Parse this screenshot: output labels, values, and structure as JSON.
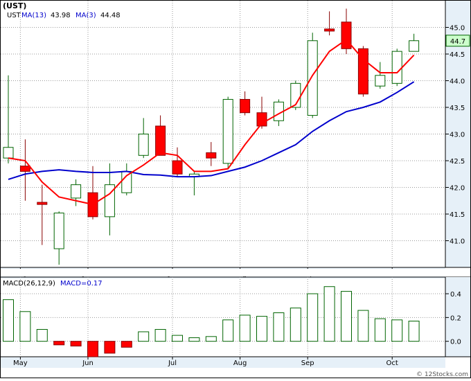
{
  "header": {
    "ticker": "(UST)",
    "symbol": "UST",
    "ma13_label": "MA(13)",
    "ma13_value": "43.98",
    "ma3_label": "MA(3)",
    "ma3_value": "44.48"
  },
  "macd_header": {
    "label": "MACD(26,12,9)",
    "value_label": "MACD=0.17"
  },
  "footer": {
    "copyright": "© 12Stocks.com"
  },
  "colors": {
    "up_candle_stroke": "#006400",
    "down_candle_fill": "#ff0000",
    "ma13_line": "#0000cc",
    "ma3_line": "#ff0000",
    "macd_bar": "#006400",
    "price_axis_bg": "#e6f0f8",
    "last_price_bg": "#ccffcc",
    "grid": "#999999"
  },
  "chart_data": [
    {
      "type": "candlestick",
      "title": "(UST)",
      "ylim": [
        40.5,
        45.5
      ],
      "y_ticks": [
        41.0,
        41.5,
        42.0,
        42.5,
        43.0,
        43.5,
        44.0,
        44.5,
        45.0
      ],
      "x_ticks": [
        {
          "label": "May",
          "index": 1
        },
        {
          "label": "Jun",
          "index": 5
        },
        {
          "label": "Jul",
          "index": 10
        },
        {
          "label": "Aug",
          "index": 14
        },
        {
          "label": "Sep",
          "index": 18
        },
        {
          "label": "Oct",
          "index": 23
        }
      ],
      "last_price_label": "44.7",
      "candles": [
        {
          "o": 42.55,
          "h": 44.1,
          "l": 42.45,
          "c": 42.75
        },
        {
          "o": 42.4,
          "h": 42.9,
          "l": 41.75,
          "c": 42.3
        },
        {
          "o": 41.72,
          "h": 42.05,
          "l": 40.92,
          "c": 41.68
        },
        {
          "o": 40.85,
          "h": 41.55,
          "l": 40.55,
          "c": 41.52
        },
        {
          "o": 41.8,
          "h": 42.15,
          "l": 41.65,
          "c": 42.05
        },
        {
          "o": 41.9,
          "h": 42.4,
          "l": 41.4,
          "c": 41.45
        },
        {
          "o": 41.45,
          "h": 42.45,
          "l": 41.1,
          "c": 42.05
        },
        {
          "o": 41.9,
          "h": 42.45,
          "l": 41.85,
          "c": 42.3
        },
        {
          "o": 42.6,
          "h": 43.3,
          "l": 42.55,
          "c": 43.0
        },
        {
          "o": 43.15,
          "h": 43.35,
          "l": 42.6,
          "c": 42.6
        },
        {
          "o": 42.5,
          "h": 42.75,
          "l": 42.2,
          "c": 42.25
        },
        {
          "o": 42.2,
          "h": 42.3,
          "l": 41.85,
          "c": 42.25
        },
        {
          "o": 42.65,
          "h": 42.85,
          "l": 42.4,
          "c": 42.55
        },
        {
          "o": 42.45,
          "h": 43.7,
          "l": 42.35,
          "c": 43.65
        },
        {
          "o": 43.65,
          "h": 43.8,
          "l": 43.35,
          "c": 43.4
        },
        {
          "o": 43.4,
          "h": 43.7,
          "l": 43.1,
          "c": 43.15
        },
        {
          "o": 43.25,
          "h": 43.65,
          "l": 43.15,
          "c": 43.6
        },
        {
          "o": 43.5,
          "h": 44.0,
          "l": 43.45,
          "c": 43.95
        },
        {
          "o": 43.35,
          "h": 44.9,
          "l": 43.3,
          "c": 44.75
        },
        {
          "o": 44.97,
          "h": 45.3,
          "l": 44.85,
          "c": 44.93
        },
        {
          "o": 45.1,
          "h": 45.35,
          "l": 44.5,
          "c": 44.6
        },
        {
          "o": 44.6,
          "h": 44.65,
          "l": 43.7,
          "c": 43.75
        },
        {
          "o": 43.9,
          "h": 44.35,
          "l": 43.85,
          "c": 44.1
        },
        {
          "o": 43.95,
          "h": 44.6,
          "l": 43.9,
          "c": 44.55
        },
        {
          "o": 44.55,
          "h": 44.88,
          "l": 44.55,
          "c": 44.75
        }
      ],
      "series": [
        {
          "name": "MA(13)",
          "values": [
            42.15,
            42.25,
            42.3,
            42.33,
            42.3,
            42.28,
            42.28,
            42.3,
            42.24,
            42.23,
            42.2,
            42.2,
            42.22,
            42.3,
            42.38,
            42.5,
            42.65,
            42.8,
            43.05,
            43.25,
            43.42,
            43.5,
            43.6,
            43.78,
            43.98
          ]
        },
        {
          "name": "MA(3)",
          "values": [
            42.55,
            42.5,
            42.1,
            41.82,
            41.75,
            41.68,
            41.88,
            42.22,
            42.42,
            42.65,
            42.6,
            42.3,
            42.3,
            42.35,
            42.8,
            43.2,
            43.38,
            43.55,
            44.1,
            44.55,
            44.77,
            44.4,
            44.15,
            44.15,
            44.48
          ]
        }
      ]
    },
    {
      "type": "bar",
      "title": "MACD(26,12,9)",
      "ylim": [
        -0.13,
        0.54
      ],
      "y_ticks": [
        0.0,
        0.2,
        0.4
      ],
      "x_ticks": [
        {
          "label": "May",
          "index": 1
        },
        {
          "label": "Jun",
          "index": 5
        },
        {
          "label": "Jul",
          "index": 10
        },
        {
          "label": "Aug",
          "index": 14
        },
        {
          "label": "Sep",
          "index": 18
        },
        {
          "label": "Oct",
          "index": 23
        }
      ],
      "values": [
        0.35,
        0.25,
        0.1,
        -0.03,
        -0.04,
        -0.13,
        -0.1,
        -0.05,
        0.08,
        0.1,
        0.05,
        0.03,
        0.04,
        0.18,
        0.22,
        0.21,
        0.24,
        0.28,
        0.4,
        0.46,
        0.42,
        0.26,
        0.19,
        0.18,
        0.17
      ]
    }
  ]
}
